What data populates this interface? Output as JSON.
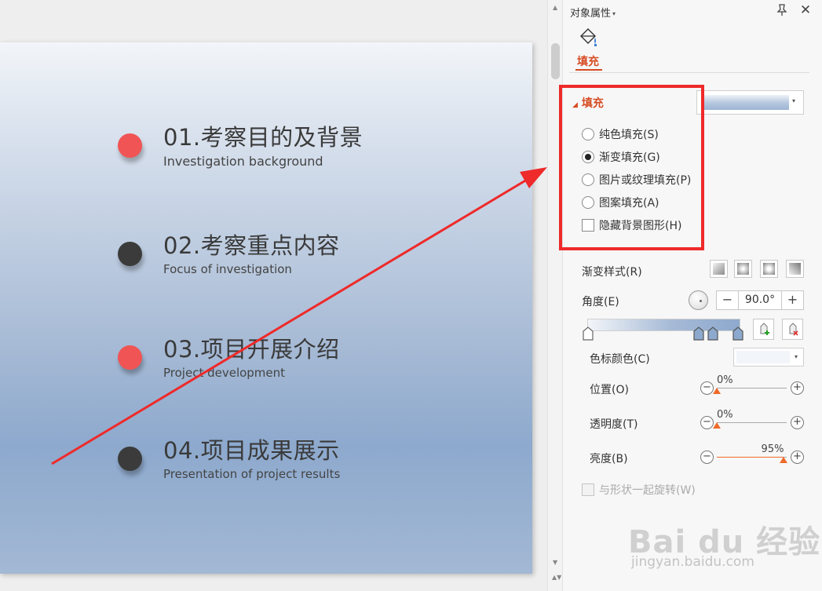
{
  "slide": {
    "items": [
      {
        "title": "01.考察目的及背景",
        "subtitle": "Investigation background",
        "dot_color": "#f05454"
      },
      {
        "title": "02.考察重点内容",
        "subtitle": "Focus of investigation",
        "dot_color": "#3b3b3b"
      },
      {
        "title": "03.项目开展介绍",
        "subtitle": "Project development",
        "dot_color": "#f05454"
      },
      {
        "title": "04.项目成果展示",
        "subtitle": "Presentation of project results",
        "dot_color": "#3b3b3b"
      }
    ],
    "annotation_color": "#ee2a2a"
  },
  "panel": {
    "title": "对象属性",
    "pin_icon": "pin-icon",
    "close_icon": "close-icon",
    "close_glyph": "✕",
    "caret_glyph": "▾",
    "fill_tab_icon": "paint-bucket-icon",
    "fill_tab_label": "填充",
    "accent_color": "#d64b21",
    "fill_section": {
      "header": "填充",
      "header_glyph": "◢",
      "options": [
        {
          "label": "纯色填充(S)",
          "selected": false
        },
        {
          "label": "渐变填充(G)",
          "selected": true
        },
        {
          "label": "图片或纹理填充(P)",
          "selected": false
        },
        {
          "label": "图案填充(A)",
          "selected": false
        }
      ],
      "hide_background": {
        "label": "隐藏背景图形(H)",
        "checked": false
      }
    },
    "gradient": {
      "style_label": "渐变样式(R)",
      "angle_label": "角度(E)",
      "angle_value": "90.0°",
      "minus_glyph": "−",
      "plus_glyph": "+",
      "stop_color_label": "色标颜色(C)",
      "position": {
        "label": "位置(O)",
        "value": "0%",
        "fraction": 0
      },
      "transparency": {
        "label": "透明度(T)",
        "value": "0%",
        "fraction": 0
      },
      "brightness": {
        "label": "亮度(B)",
        "value": "95%",
        "fraction": 0.95
      },
      "rotate_with_shape": {
        "label": "与形状一起旋转(W)",
        "checked": false,
        "enabled": false
      }
    }
  },
  "scrollbar": {
    "up_glyph": "▲",
    "down_glyph": "▼",
    "end_glyph": "▲▼"
  },
  "watermark": {
    "logo": "Bai du 经验",
    "url": "jingyan.baidu.com"
  }
}
